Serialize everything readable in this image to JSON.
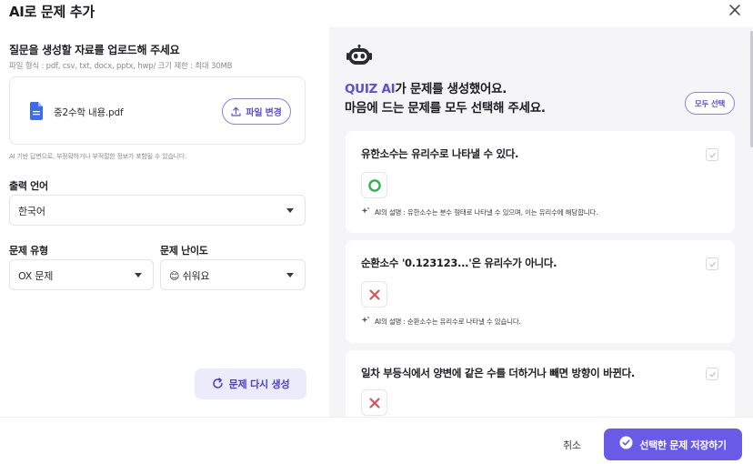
{
  "dialog": {
    "title": "AI로 문제 추가"
  },
  "upload": {
    "title": "질문을 생성할 자료를 업로드해 주세요",
    "hint": "파일 형식 : pdf, csv, txt, docx, pptx, hwp/ 크기 제한 : 최대 30MB",
    "file_name": "중2수학 내용.pdf",
    "change_label": "파일 변경",
    "ai_warning": "AI 기반 답변으로, 부정확하거나 부적절한 정보가 포함될 수 있습니다."
  },
  "settings": {
    "language_label": "출력 언어",
    "language_value": "한국어",
    "type_label": "문제 유형",
    "type_value": "OX 문제",
    "difficulty_label": "문제 난이도",
    "difficulty_value": "쉬워요",
    "difficulty_emoji": "😊",
    "regenerate_label": "문제 다시 생성"
  },
  "results": {
    "brand": "QUIZ AI",
    "headline_rest": "가 문제를 생성했어요.",
    "headline_line2": "마음에 드는 문제를 모두 선택해 주세요.",
    "select_all_label": "모두 선택",
    "questions": [
      {
        "text": "유한소수는 유리수로 나타낼 수 있다.",
        "answer": "O",
        "explanation": "AI의 설명 : 유한소수는 분수 형태로 나타낼 수 있으며, 이는 유리수에 해당합니다."
      },
      {
        "text": "순환소수 '0.123123...'은 유리수가 아니다.",
        "answer": "X",
        "explanation": "AI의 설명 : 순환소수는 유리수로 나타낼 수 있습니다."
      },
      {
        "text": "일차 부등식에서 양변에 같은 수를 더하거나 빼면 방향이 바뀐다.",
        "answer": "X",
        "explanation": ""
      }
    ]
  },
  "footer": {
    "cancel_label": "취소",
    "save_label": "선택한 문제 저장하기"
  },
  "colors": {
    "accent": "#6a5ae8",
    "brand_text": "#5b4fd6",
    "o_mark": "#22b34a",
    "x_mark": "#e5484d"
  }
}
